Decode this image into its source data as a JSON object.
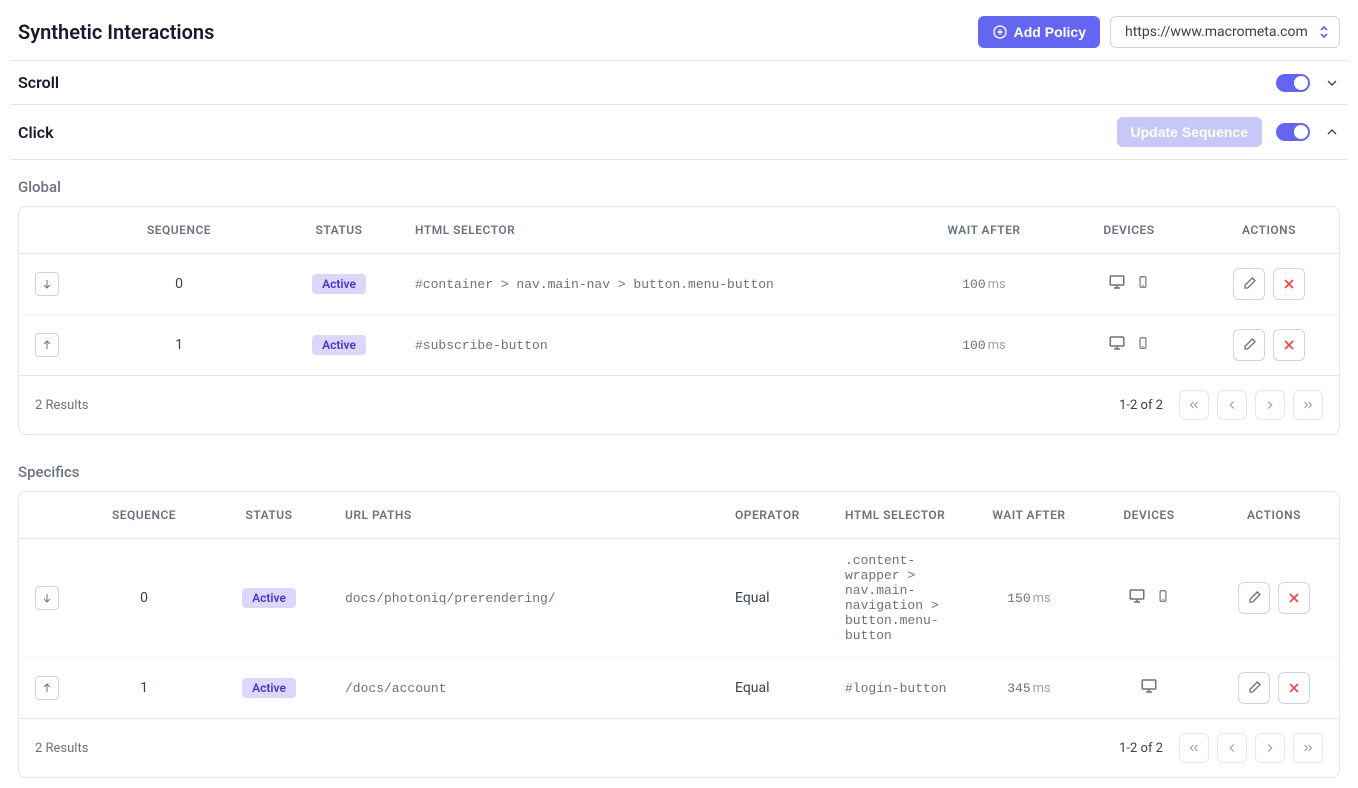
{
  "header": {
    "title": "Synthetic Interactions",
    "add_policy_label": "Add Policy",
    "url_selected": "https://www.macrometa.com"
  },
  "sections": {
    "scroll": {
      "title": "Scroll",
      "enabled": true,
      "expanded": false
    },
    "click": {
      "title": "Click",
      "enabled": true,
      "expanded": true,
      "update_sequence_label": "Update Sequence"
    }
  },
  "global": {
    "heading": "Global",
    "columns": {
      "sequence": "SEQUENCE",
      "status": "STATUS",
      "html_selector": "HTML SELECTOR",
      "wait_after": "WAIT AFTER",
      "devices": "DEVICES",
      "actions": "ACTIONS"
    },
    "rows": [
      {
        "direction": "down",
        "sequence": "0",
        "status": "Active",
        "selector": "#container > nav.main-nav > button.menu-button",
        "wait_value": "100",
        "wait_unit": "ms",
        "devices": [
          "desktop",
          "mobile"
        ]
      },
      {
        "direction": "up",
        "sequence": "1",
        "status": "Active",
        "selector": "#subscribe-button",
        "wait_value": "100",
        "wait_unit": "ms",
        "devices": [
          "desktop",
          "mobile"
        ]
      }
    ],
    "footer": {
      "results": "2 Results",
      "page_info": "1-2 of 2"
    }
  },
  "specifics": {
    "heading": "Specifics",
    "columns": {
      "sequence": "SEQUENCE",
      "status": "STATUS",
      "url_paths": "URL PATHS",
      "operator": "OPERATOR",
      "html_selector": "HTML SELECTOR",
      "wait_after": "WAIT AFTER",
      "devices": "DEVICES",
      "actions": "ACTIONS"
    },
    "rows": [
      {
        "direction": "down",
        "sequence": "0",
        "status": "Active",
        "url_paths": "docs/photoniq/prerendering/",
        "operator": "Equal",
        "selector": ".content-wrapper > nav.main-navigation > button.menu-button",
        "wait_value": "150",
        "wait_unit": "ms",
        "devices": [
          "desktop",
          "mobile"
        ]
      },
      {
        "direction": "up",
        "sequence": "1",
        "status": "Active",
        "url_paths": "/docs/account",
        "operator": "Equal",
        "selector": "#login-button",
        "wait_value": "345",
        "wait_unit": "ms",
        "devices": [
          "desktop"
        ]
      }
    ],
    "footer": {
      "results": "2 Results",
      "page_info": "1-2 of 2"
    }
  }
}
